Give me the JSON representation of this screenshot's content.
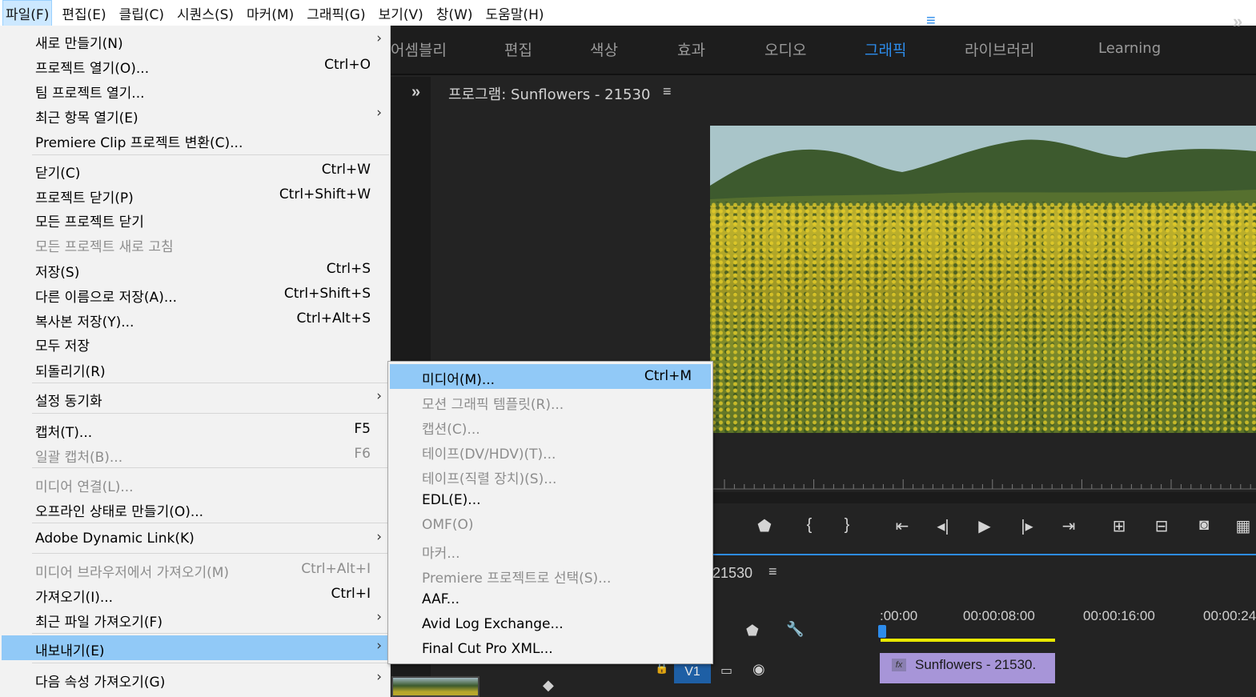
{
  "menubar": {
    "items": [
      "파일(F)",
      "편집(E)",
      "클립(C)",
      "시퀀스(S)",
      "마커(M)",
      "그래픽(G)",
      "보기(V)",
      "창(W)",
      "도움말(H)"
    ]
  },
  "workspaces": {
    "tabs": [
      "어셈블리",
      "편집",
      "색상",
      "효과",
      "오디오",
      "그래픽",
      "라이브러리",
      "Learning"
    ],
    "active": "그래픽"
  },
  "program": {
    "title": "프로그램: Sunflowers - 21530"
  },
  "timeline": {
    "sequence_name": "21530",
    "timecodes": [
      ":00:00",
      "00:00:08:00",
      "00:00:16:00",
      "00:00:24"
    ],
    "track": "V1",
    "clip_name": "Sunflowers - 21530.",
    "clip_badge": "fx"
  },
  "file_menu": {
    "items": [
      {
        "label": "새로 만들기(N)",
        "shortcut": "",
        "submenu": true,
        "disabled": false
      },
      {
        "label": "프로젝트 열기(O)...",
        "shortcut": "Ctrl+O",
        "submenu": false,
        "disabled": false
      },
      {
        "label": "팀 프로젝트 열기...",
        "shortcut": "",
        "submenu": false,
        "disabled": false
      },
      {
        "label": "최근 항목 열기(E)",
        "shortcut": "",
        "submenu": true,
        "disabled": false
      },
      {
        "label": "Premiere Clip 프로젝트 변환(C)...",
        "shortcut": "",
        "submenu": false,
        "disabled": false
      },
      {
        "label": "닫기(C)",
        "shortcut": "Ctrl+W",
        "submenu": false,
        "disabled": false
      },
      {
        "label": "프로젝트 닫기(P)",
        "shortcut": "Ctrl+Shift+W",
        "submenu": false,
        "disabled": false
      },
      {
        "label": "모든 프로젝트 닫기",
        "shortcut": "",
        "submenu": false,
        "disabled": false
      },
      {
        "label": "모든 프로젝트 새로 고침",
        "shortcut": "",
        "submenu": false,
        "disabled": true
      },
      {
        "label": "저장(S)",
        "shortcut": "Ctrl+S",
        "submenu": false,
        "disabled": false
      },
      {
        "label": "다른 이름으로 저장(A)...",
        "shortcut": "Ctrl+Shift+S",
        "submenu": false,
        "disabled": false
      },
      {
        "label": "복사본 저장(Y)...",
        "shortcut": "Ctrl+Alt+S",
        "submenu": false,
        "disabled": false
      },
      {
        "label": "모두 저장",
        "shortcut": "",
        "submenu": false,
        "disabled": false
      },
      {
        "label": "되돌리기(R)",
        "shortcut": "",
        "submenu": false,
        "disabled": false
      },
      {
        "label": "설정 동기화",
        "shortcut": "",
        "submenu": true,
        "disabled": false
      },
      {
        "label": "캡처(T)...",
        "shortcut": "F5",
        "submenu": false,
        "disabled": false
      },
      {
        "label": "일괄 캡처(B)...",
        "shortcut": "F6",
        "submenu": false,
        "disabled": true
      },
      {
        "label": "미디어 연결(L)...",
        "shortcut": "",
        "submenu": false,
        "disabled": true
      },
      {
        "label": "오프라인 상태로 만들기(O)...",
        "shortcut": "",
        "submenu": false,
        "disabled": false
      },
      {
        "label": "Adobe Dynamic Link(K)",
        "shortcut": "",
        "submenu": true,
        "disabled": false
      },
      {
        "label": "미디어 브라우저에서 가져오기(M)",
        "shortcut": "Ctrl+Alt+I",
        "submenu": false,
        "disabled": true
      },
      {
        "label": "가져오기(I)...",
        "shortcut": "Ctrl+I",
        "submenu": false,
        "disabled": false
      },
      {
        "label": "최근 파일 가져오기(F)",
        "shortcut": "",
        "submenu": true,
        "disabled": false
      },
      {
        "label": "내보내기(E)",
        "shortcut": "",
        "submenu": true,
        "disabled": false
      },
      {
        "label": "다음 속성 가져오기(G)",
        "shortcut": "",
        "submenu": true,
        "disabled": false
      }
    ]
  },
  "export_menu": {
    "items": [
      {
        "label": "미디어(M)...",
        "shortcut": "Ctrl+M",
        "disabled": false
      },
      {
        "label": "모션 그래픽 템플릿(R)...",
        "shortcut": "",
        "disabled": true
      },
      {
        "label": "캡션(C)...",
        "shortcut": "",
        "disabled": true
      },
      {
        "label": "테이프(DV/HDV)(T)...",
        "shortcut": "",
        "disabled": true
      },
      {
        "label": "테이프(직렬 장치)(S)...",
        "shortcut": "",
        "disabled": true
      },
      {
        "label": "EDL(E)...",
        "shortcut": "",
        "disabled": false
      },
      {
        "label": "OMF(O)",
        "shortcut": "",
        "disabled": true
      },
      {
        "label": "마커...",
        "shortcut": "",
        "disabled": true
      },
      {
        "label": "Premiere 프로젝트로 선택(S)...",
        "shortcut": "",
        "disabled": true
      },
      {
        "label": "AAF...",
        "shortcut": "",
        "disabled": false
      },
      {
        "label": "Avid Log Exchange...",
        "shortcut": "",
        "disabled": false
      },
      {
        "label": "Final Cut Pro XML...",
        "shortcut": "",
        "disabled": false
      }
    ]
  },
  "colors": {
    "highlight": "#91c9f7",
    "accent": "#2d8ceb",
    "clip": "#a795d8"
  }
}
